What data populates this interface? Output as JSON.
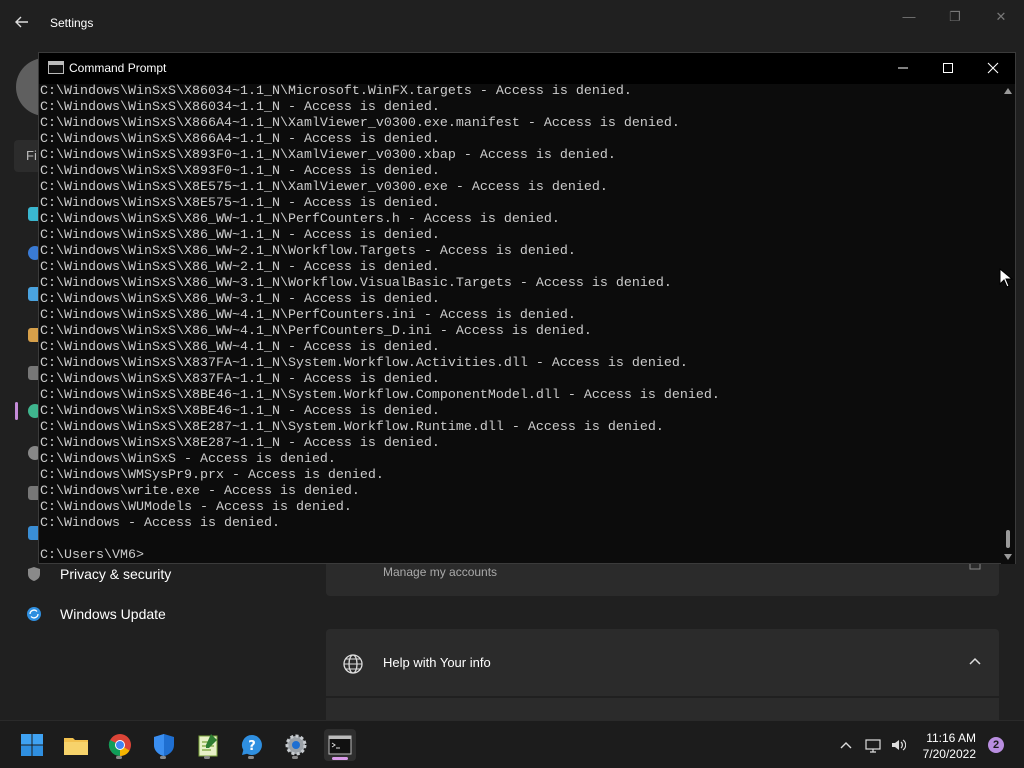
{
  "settings": {
    "title": "Settings",
    "find_stub": "Fi",
    "nav": {
      "privacy": "Privacy & security",
      "windows_update": "Windows Update"
    },
    "manage_accounts": "Manage my accounts",
    "help_card_title": "Help with Your info"
  },
  "cmd": {
    "title": "Command Prompt",
    "lines": [
      "C:\\Windows\\WinSxS\\X86034~1.1_N\\Microsoft.WinFX.targets - Access is denied.",
      "C:\\Windows\\WinSxS\\X86034~1.1_N - Access is denied.",
      "C:\\Windows\\WinSxS\\X866A4~1.1_N\\XamlViewer_v0300.exe.manifest - Access is denied.",
      "C:\\Windows\\WinSxS\\X866A4~1.1_N - Access is denied.",
      "C:\\Windows\\WinSxS\\X893F0~1.1_N\\XamlViewer_v0300.xbap - Access is denied.",
      "C:\\Windows\\WinSxS\\X893F0~1.1_N - Access is denied.",
      "C:\\Windows\\WinSxS\\X8E575~1.1_N\\XamlViewer_v0300.exe - Access is denied.",
      "C:\\Windows\\WinSxS\\X8E575~1.1_N - Access is denied.",
      "C:\\Windows\\WinSxS\\X86_WW~1.1_N\\PerfCounters.h - Access is denied.",
      "C:\\Windows\\WinSxS\\X86_WW~1.1_N - Access is denied.",
      "C:\\Windows\\WinSxS\\X86_WW~2.1_N\\Workflow.Targets - Access is denied.",
      "C:\\Windows\\WinSxS\\X86_WW~2.1_N - Access is denied.",
      "C:\\Windows\\WinSxS\\X86_WW~3.1_N\\Workflow.VisualBasic.Targets - Access is denied.",
      "C:\\Windows\\WinSxS\\X86_WW~3.1_N - Access is denied.",
      "C:\\Windows\\WinSxS\\X86_WW~4.1_N\\PerfCounters.ini - Access is denied.",
      "C:\\Windows\\WinSxS\\X86_WW~4.1_N\\PerfCounters_D.ini - Access is denied.",
      "C:\\Windows\\WinSxS\\X86_WW~4.1_N - Access is denied.",
      "C:\\Windows\\WinSxS\\X837FA~1.1_N\\System.Workflow.Activities.dll - Access is denied.",
      "C:\\Windows\\WinSxS\\X837FA~1.1_N - Access is denied.",
      "C:\\Windows\\WinSxS\\X8BE46~1.1_N\\System.Workflow.ComponentModel.dll - Access is denied.",
      "C:\\Windows\\WinSxS\\X8BE46~1.1_N - Access is denied.",
      "C:\\Windows\\WinSxS\\X8E287~1.1_N\\System.Workflow.Runtime.dll - Access is denied.",
      "C:\\Windows\\WinSxS\\X8E287~1.1_N - Access is denied.",
      "C:\\Windows\\WinSxS - Access is denied.",
      "C:\\Windows\\WMSysPr9.prx - Access is denied.",
      "C:\\Windows\\write.exe - Access is denied.",
      "C:\\Windows\\WUModels - Access is denied.",
      "C:\\Windows - Access is denied.",
      "",
      "C:\\Users\\VM6>"
    ]
  },
  "taskbar": {
    "apps": [
      "start-icon",
      "file-explorer-icon",
      "chrome-icon",
      "windows-security-icon",
      "notepad-icon",
      "get-help-icon",
      "settings-icon",
      "command-prompt-icon"
    ],
    "time": "11:16 AM",
    "date": "7/20/2022",
    "notification_count": "2"
  }
}
